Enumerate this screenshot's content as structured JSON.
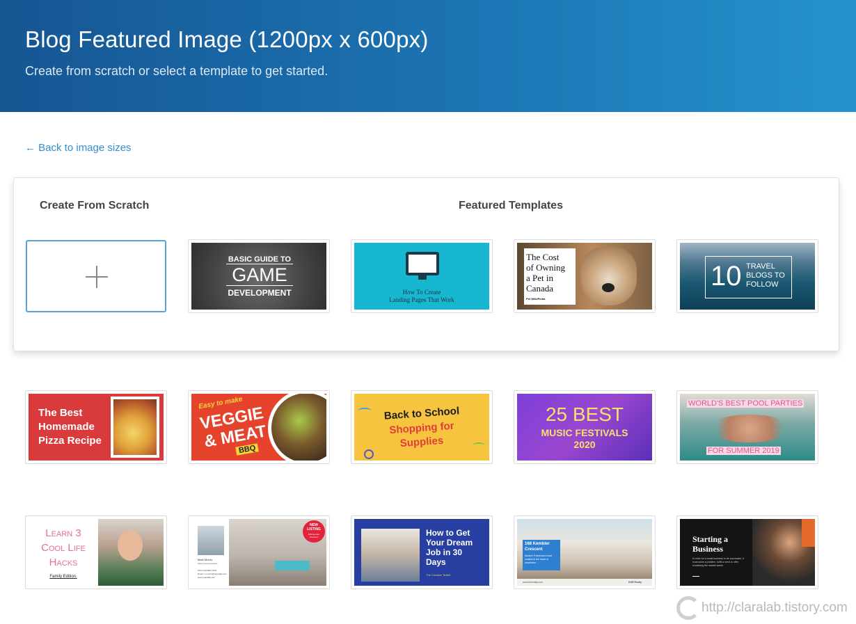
{
  "header": {
    "title": "Blog Featured Image (1200px x 600px)",
    "subtitle": "Create from scratch or select a template to get started."
  },
  "nav": {
    "back_label": "← Back to image sizes"
  },
  "panel": {
    "scratch_title": "Create From Scratch",
    "featured_title": "Featured Templates"
  },
  "templates": {
    "game": {
      "line1": "BASIC GUIDE TO",
      "line2": "GAME",
      "line3": "DEVELOPMENT"
    },
    "landing": {
      "line1": "How To Create",
      "line2": "Landing Pages That Work"
    },
    "pet": {
      "line1": "The Cost",
      "line2": "of Owning",
      "line3": "a Pet in",
      "line4": "Canada",
      "credit": "Pet Wiki/Pedia"
    },
    "travel": {
      "number": "10",
      "line1": "TRAVEL",
      "line2": "BLOGS TO",
      "line3": "FOLLOW"
    },
    "pizza": {
      "line1": "The Best",
      "line2": "Homemade",
      "line3": "Pizza Recipe"
    },
    "veggie": {
      "line1": "Easy to make",
      "line2": "VEGGIE",
      "line3": "& MEAT",
      "line4": "BBQ"
    },
    "school": {
      "line1": "Back to School",
      "line2": "Shopping for",
      "line3": "Supplies"
    },
    "music": {
      "line1": "25 BEST",
      "line2": "MUSIC FESTIVALS",
      "line3": "2020"
    },
    "pool": {
      "line1": "WORLD'S BEST POOL PARTIES",
      "line2": "FOR SUMMER 2019"
    },
    "learn": {
      "line1": "Learn 3",
      "line2": "Cool Life",
      "line3": "Hacks",
      "line4": "Family Edition."
    },
    "listing": {
      "badge1": "NEW",
      "badge2": "LISTING",
      "badge3": "168 Kember Crescent",
      "name": "Mark Morris",
      "role": "Sales Representative",
      "phone": "Phone:(0)4964-9797",
      "email": "Email: m.morris@reprealty.com",
      "web": "www.reprealty.com"
    },
    "dream": {
      "line1": "How to Get",
      "line2": "Your Dream",
      "line3": "Job in 30",
      "line4": "Days",
      "footer": "The Creative Toolkit"
    },
    "kembler": {
      "line1": "168 Kembler",
      "line2": "Crescent",
      "line3": "Modern 3 bedroom home located in the heart of downtown.",
      "footer_left": "www.khrrealty.com",
      "footer_right": "KHR Realty"
    },
    "business": {
      "line1": "Starting a",
      "line2": "Business",
      "line3": "In order for a small business to be successful, it must solve a problem, fulfill a need or offer something the market wants."
    }
  },
  "watermark": {
    "text": "http://claralab.tistory.com"
  }
}
